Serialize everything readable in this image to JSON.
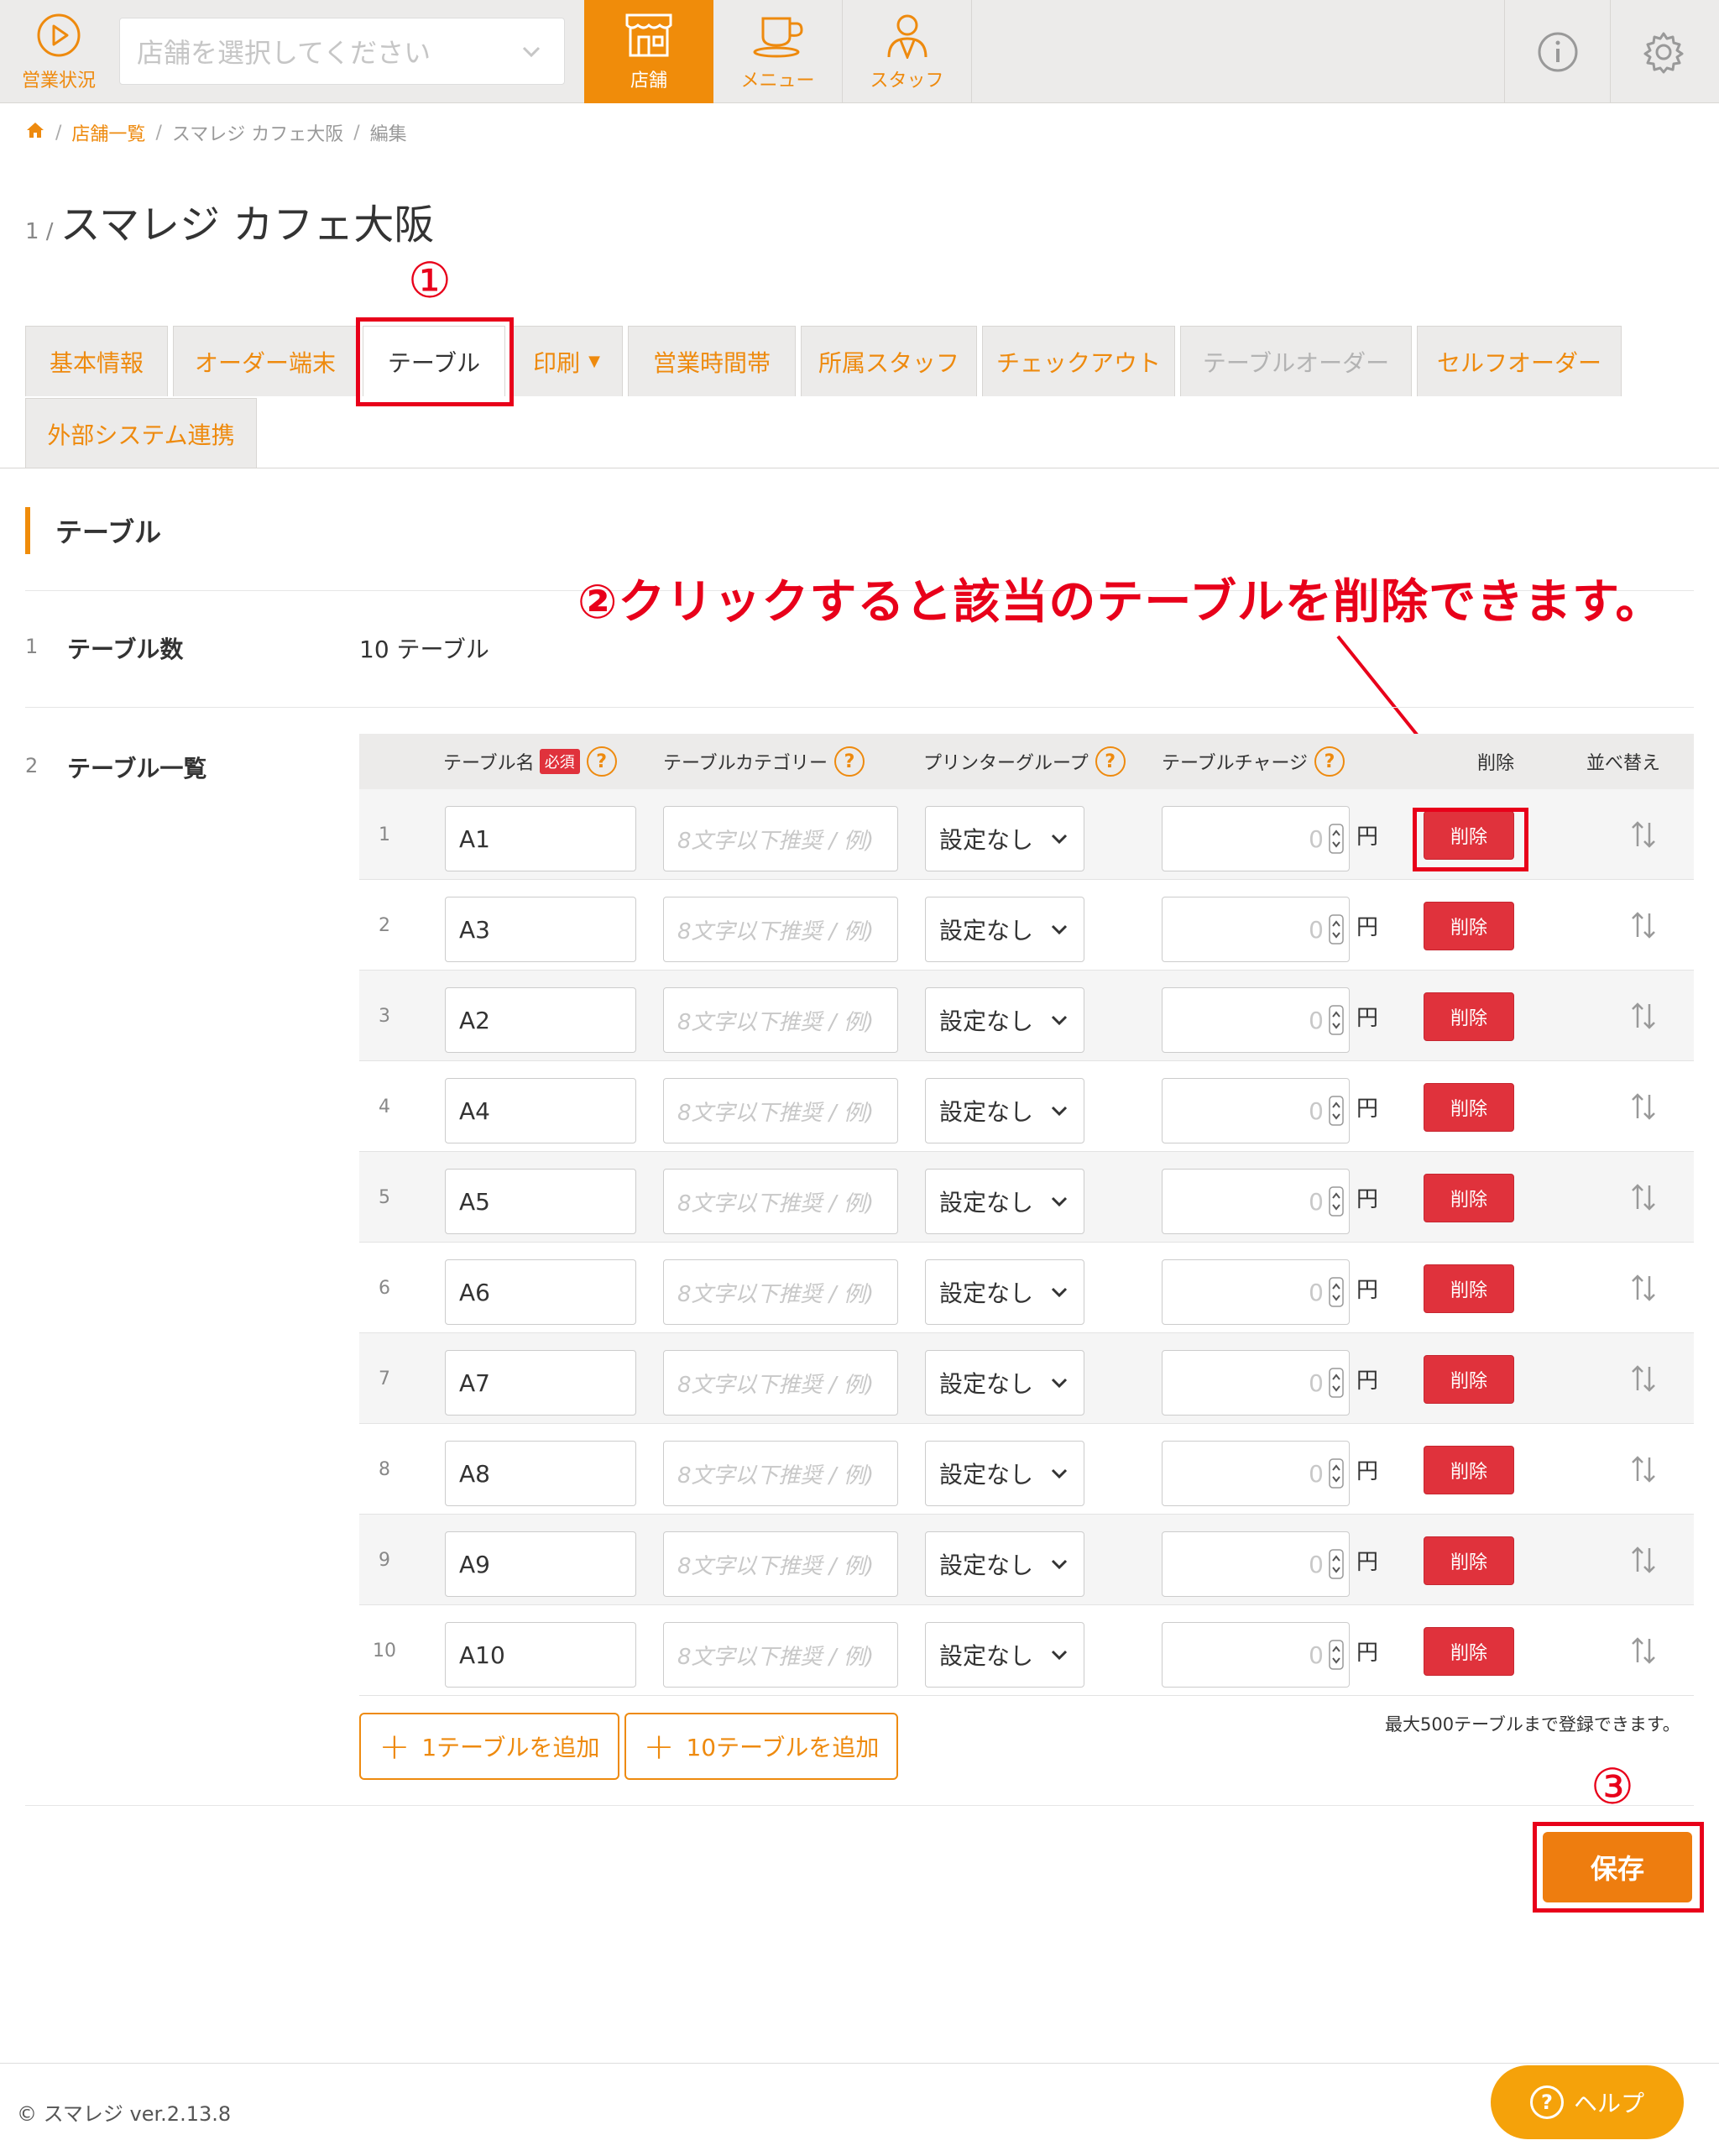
{
  "header": {
    "status_label": "営業状況",
    "store_select_placeholder": "店舗を選択してください",
    "nav": [
      {
        "label": "店舗",
        "icon": "store-icon",
        "active": true
      },
      {
        "label": "メニュー",
        "icon": "cup-icon",
        "active": false
      },
      {
        "label": "スタッフ",
        "icon": "staff-icon",
        "active": false
      }
    ],
    "accent_color": "#f08c0a"
  },
  "breadcrumb": {
    "items": [
      "店舗一覧",
      "スマレジ カフェ大阪",
      "編集"
    ],
    "separator": "/"
  },
  "page": {
    "number": "1 /",
    "title": "スマレジ カフェ大阪"
  },
  "annotations": {
    "mark1": "①",
    "note2": "②クリックすると該当のテーブルを削除できます。",
    "mark3": "③",
    "color": "#e8001a"
  },
  "tabs": [
    {
      "label": "基本情報"
    },
    {
      "label": "オーダー端末"
    },
    {
      "label": "テーブル"
    },
    {
      "label": "印刷"
    },
    {
      "label": "営業時間帯"
    },
    {
      "label": "所属スタッフ"
    },
    {
      "label": "チェックアウト"
    },
    {
      "label": "テーブルオーダー"
    },
    {
      "label": "セルフオーダー"
    },
    {
      "label": "外部システム連携"
    }
  ],
  "section": {
    "title": "テーブル",
    "row1": {
      "num": "1",
      "label": "テーブル数",
      "value": "10 テーブル"
    },
    "row2": {
      "num": "2",
      "label": "テーブル一覧"
    }
  },
  "table": {
    "headers": {
      "name": "テーブル名",
      "required": "必須",
      "category": "テーブルカテゴリー",
      "printer": "プリンターグループ",
      "charge": "テーブルチャージ",
      "delete": "削除",
      "sort": "並べ替え",
      "help_mark": "?"
    },
    "category_placeholder": "8文字以下推奨 / 例)",
    "printer_value": "設定なし",
    "charge_value": "0",
    "yen": "円",
    "delete_label": "削除",
    "rows": [
      {
        "index": "1",
        "name": "A1"
      },
      {
        "index": "2",
        "name": "A3"
      },
      {
        "index": "3",
        "name": "A2"
      },
      {
        "index": "4",
        "name": "A4"
      },
      {
        "index": "5",
        "name": "A5"
      },
      {
        "index": "6",
        "name": "A6"
      },
      {
        "index": "7",
        "name": "A7"
      },
      {
        "index": "8",
        "name": "A8"
      },
      {
        "index": "9",
        "name": "A9"
      },
      {
        "index": "10",
        "name": "A10"
      }
    ],
    "add_one": "1テーブルを追加",
    "add_ten": "10テーブルを追加",
    "max_note": "最大500テーブルまで登録できます。"
  },
  "save_label": "保存",
  "footer": {
    "copyright": "© スマレジ ver.2.13.8",
    "help_label": "ヘルプ",
    "help_mark": "?"
  }
}
